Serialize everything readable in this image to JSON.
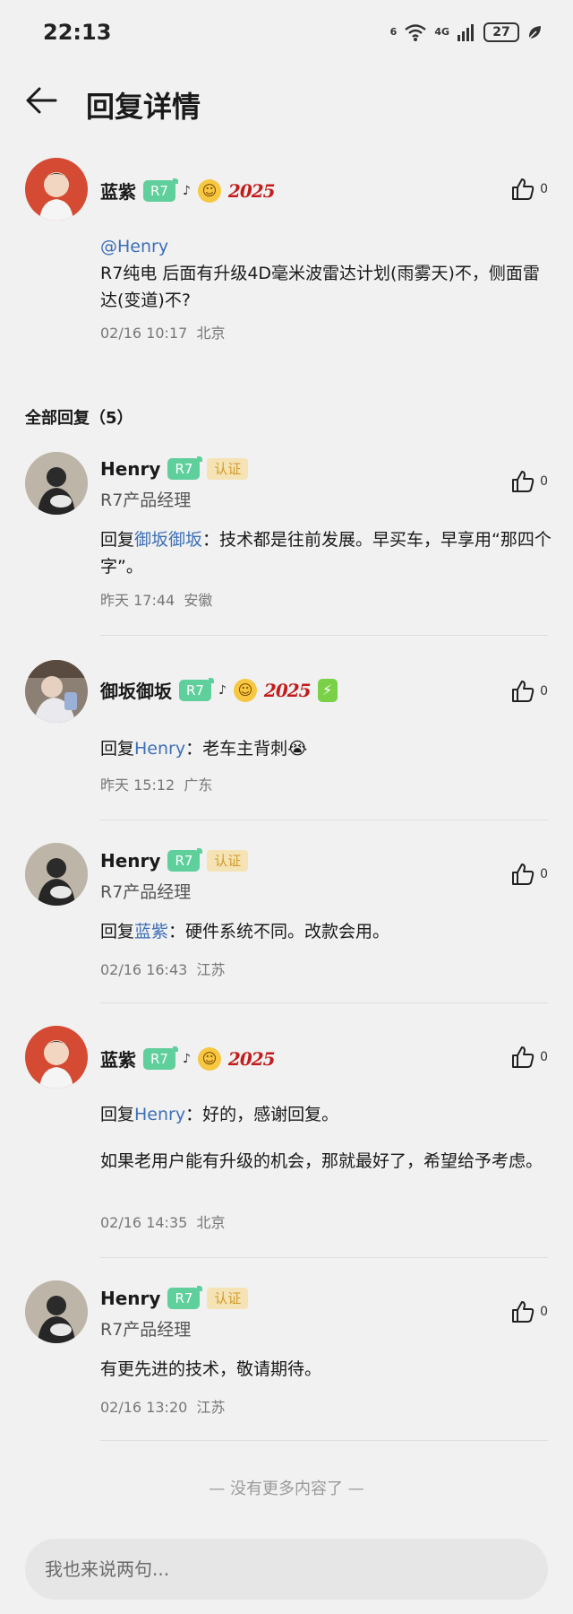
{
  "status_bar": {
    "time": "22:13",
    "network": "4G",
    "wifi_label": "6",
    "battery": "27"
  },
  "header": {
    "title": "回复详情"
  },
  "main_comment": {
    "user": "蓝紫",
    "badge": "R7",
    "deco": "2025",
    "mention": "@Henry",
    "text": "R7纯电 后面有升级4D毫米波雷达计划(雨雾天)不，侧面雷达(变道)不?",
    "date": "02/16 10:17",
    "location": "北京",
    "likes": "0"
  },
  "replies_header": "全部回复（5）",
  "replies": [
    {
      "user": "Henry",
      "badge": "R7",
      "cert": "认证",
      "subtitle": "R7产品经理",
      "reply_prefix": "回复",
      "reply_to": "御坂御坂",
      "text": "：技术都是往前发展。早买车，早享用“那四个字”。",
      "date": "昨天 17:44",
      "location": "安徽",
      "likes": "0"
    },
    {
      "user": "御坂御坂",
      "badge": "R7",
      "deco": "2025",
      "reply_prefix": "回复",
      "reply_to": "Henry",
      "text": "：老车主背刺😭",
      "date": "昨天 15:12",
      "location": "广东",
      "likes": "0"
    },
    {
      "user": "Henry",
      "badge": "R7",
      "cert": "认证",
      "subtitle": "R7产品经理",
      "reply_prefix": "回复",
      "reply_to": "蓝紫",
      "text": "：硬件系统不同。改款会用。",
      "date": "02/16 16:43",
      "location": "江苏",
      "likes": "0"
    },
    {
      "user": "蓝紫",
      "badge": "R7",
      "deco": "2025",
      "reply_prefix": "回复",
      "reply_to": "Henry",
      "text": "：好的，感谢回复。",
      "text2": "如果老用户能有升级的机会，那就最好了，希望给予考虑。",
      "date": "02/16 14:35",
      "location": "北京",
      "likes": "0"
    },
    {
      "user": "Henry",
      "badge": "R7",
      "cert": "认证",
      "subtitle": "R7产品经理",
      "text": "有更先进的技术，敬请期待。",
      "date": "02/16 13:20",
      "location": "江苏",
      "likes": "0"
    }
  ],
  "footer_note": "— 没有更多内容了 —",
  "input": {
    "placeholder": "我也来说两句..."
  },
  "icons": [
    "back-arrow-icon",
    "wifi-icon",
    "signal-icon",
    "battery-icon",
    "leaf-icon",
    "thumbs-up-icon",
    "smiley-icon",
    "music-note-icon",
    "bolt-icon"
  ],
  "colors": {
    "badge_green": "#5fcf9c",
    "link_blue": "#3d6fb6",
    "cert_gold": "#d19a2a",
    "deco_red": "#c21c1c"
  }
}
